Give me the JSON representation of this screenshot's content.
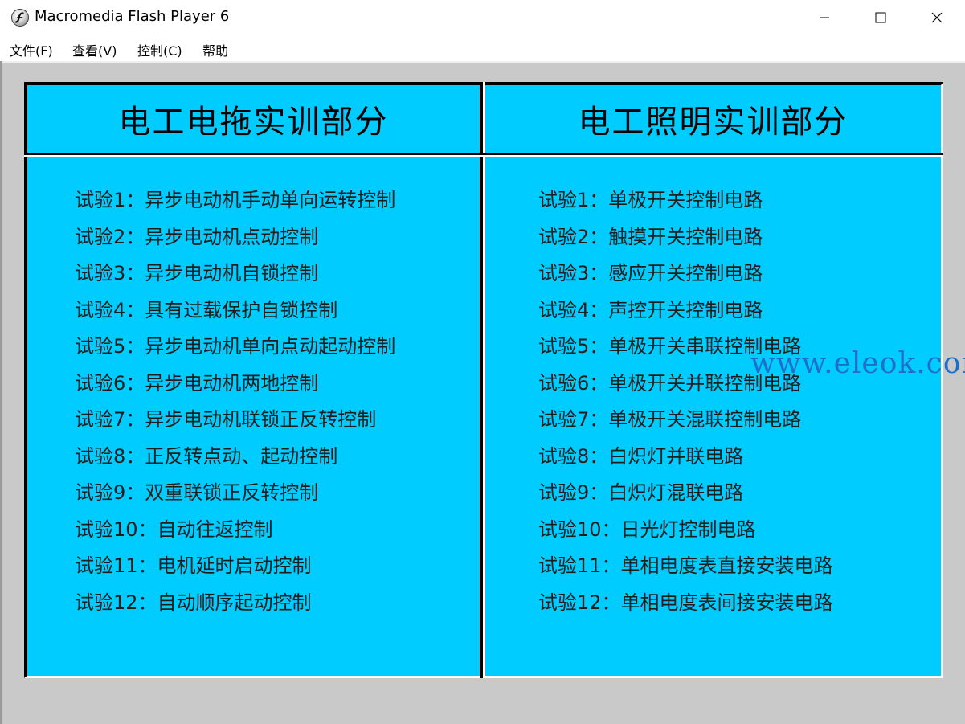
{
  "window": {
    "title": "Macromedia Flash Player 6",
    "icon": "flash-player-icon",
    "controls": {
      "minimize": "minimize-icon",
      "maximize": "maximize-icon",
      "close": "close-icon"
    }
  },
  "menu": {
    "file": "文件(F)",
    "view": "查看(V)",
    "control": "控制(C)",
    "help": "帮助"
  },
  "content": {
    "left_header": "电工电拖实训部分",
    "right_header": "电工照明实训部分",
    "left_items": [
      "试验1：异步电动机手动单向运转控制",
      "试验2：异步电动机点动控制",
      "试验3：异步电动机自锁控制",
      "试验4：具有过载保护自锁控制",
      "试验5：异步电动机单向点动起动控制",
      "试验6：异步电动机两地控制",
      "试验7：异步电动机联锁正反转控制",
      "试验8：正反转点动、起动控制",
      "试验9：双重联锁正反转控制",
      "试验10：自动往返控制",
      "试验11：电机延时启动控制",
      "试验12：自动顺序起动控制"
    ],
    "right_items": [
      "试验1：单极开关控制电路",
      "试验2：触摸开关控制电路",
      "试验3：感应开关控制电路",
      "试验4：声控开关控制电路",
      "试验5：单极开关串联控制电路",
      "试验6：单极开关并联控制电路",
      "试验7：单极开关混联控制电路",
      "试验8：白炽灯并联电路",
      "试验9：白炽灯混联电路",
      "试验10：日光灯控制电路",
      "试验11：单相电度表直接安装电路",
      "试验12：单相电度表间接安装电路"
    ],
    "watermark": "www.eleok.com"
  },
  "colors": {
    "panel_background": "#00ccff",
    "stage_background": "#c9c9c9",
    "watermark": "#1e6fc8"
  }
}
